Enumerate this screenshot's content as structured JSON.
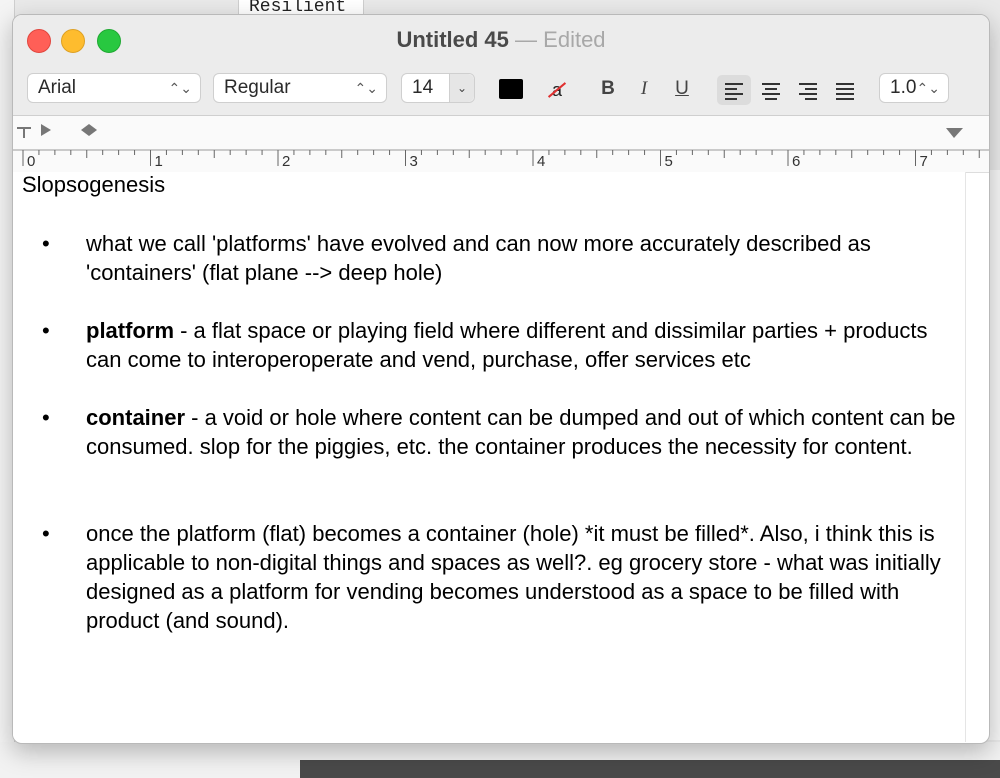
{
  "background": {
    "top_window_text": "Resilient"
  },
  "window": {
    "title": "Untitled 45",
    "separator": "—",
    "status": "Edited"
  },
  "toolbar": {
    "font_family": "Arial",
    "font_style": "Regular",
    "font_size": "14",
    "text_color": "#000000",
    "highlight_glyph": "a",
    "bold": "B",
    "italic": "I",
    "underline": "U",
    "line_spacing": "1.0",
    "arrows_glyph": "⌃⌄",
    "dropdown_glyph": "⌄"
  },
  "ruler": {
    "labels": [
      "0",
      "1",
      "2",
      "3",
      "4",
      "5",
      "6",
      "7"
    ]
  },
  "document": {
    "heading": "Slopsogenesis",
    "items": [
      {
        "bold": "",
        "text": "what we call 'platforms' have evolved and can now more accurately described as 'containers' (flat plane --> deep hole)"
      },
      {
        "bold": "platform",
        "text": " - a flat space or playing field where different and dissimilar parties + products can come to interoperoperate and vend, purchase, offer services etc"
      },
      {
        "bold": "container",
        "text": " - a void or hole where content can be dumped and out of which content can be consumed. slop for the piggies, etc. the container produces the necessity for content."
      },
      {
        "bold": "",
        "text": "once the platform (flat) becomes a container (hole) *it must be filled*. Also, i think this is applicable to non-digital things and spaces as well?. eg grocery store - what was initially designed as a platform for vending becomes understood as a space to be filled with product (and sound)."
      }
    ],
    "bullet": "•"
  }
}
